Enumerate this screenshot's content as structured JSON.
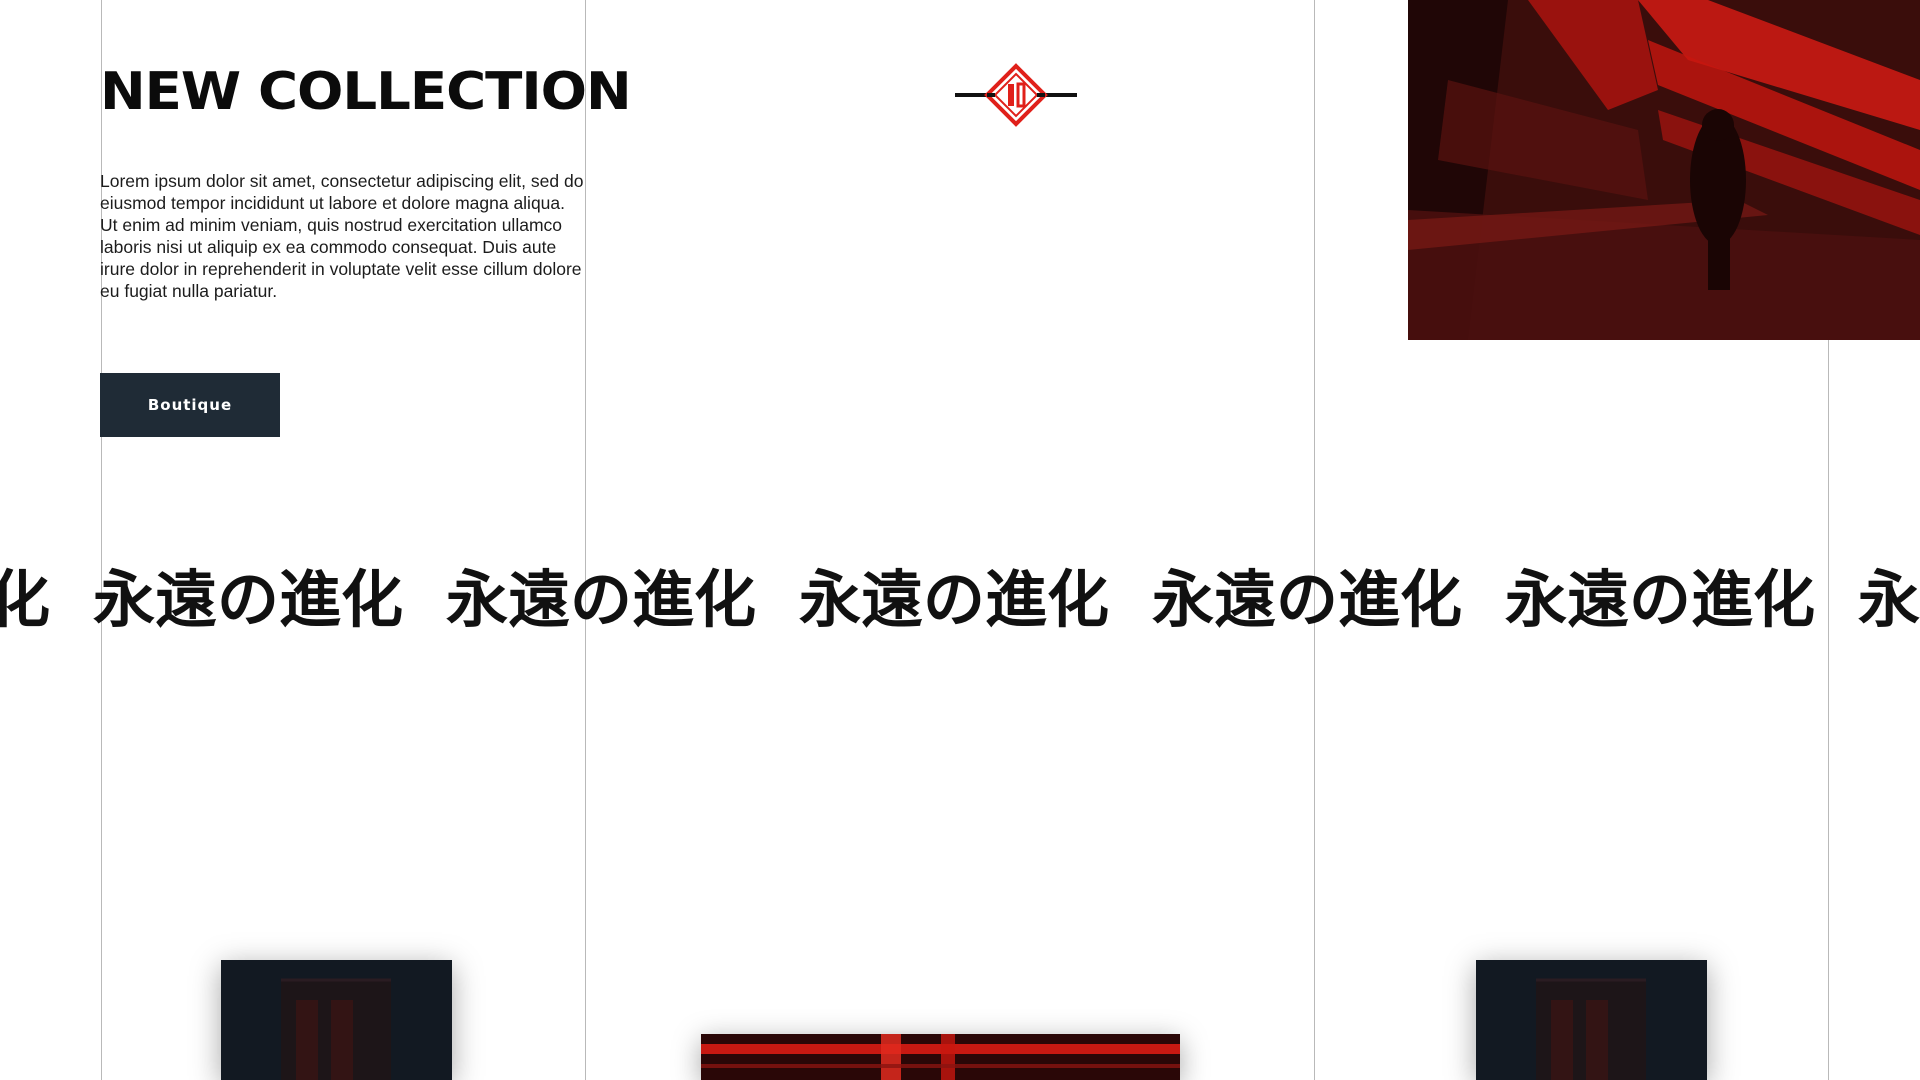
{
  "hero": {
    "title": "NEW COLLECTION",
    "description": "Lorem ipsum dolor sit amet, consectetur adipiscing elit, sed do eiusmod tempor incididunt ut labore et dolore magna aliqua. Ut enim ad minim veniam, quis nostrud exercitation ullamco laboris nisi ut aliquip ex ea commodo consequat. Duis aute irure dolor in reprehenderit in voluptate velit esse cillum dolore eu fugiat nulla pariatur.",
    "button_label": "Boutique"
  },
  "marquee": {
    "items": [
      "永遠の進化",
      "永遠の進化",
      "永遠の進化",
      "永遠の進化",
      "永遠の進化",
      "永遠の進化",
      "永遠の進化"
    ]
  },
  "colors": {
    "accent": "#e0201a",
    "button_bg": "#1f2b36",
    "text": "#0b0b0b",
    "grid_line": "#b9b9b9"
  },
  "icons": {
    "logo": "diamond-monogram-logo"
  }
}
